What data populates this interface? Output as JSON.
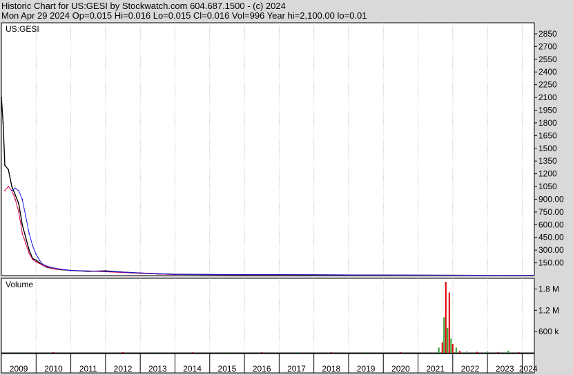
{
  "header": {
    "line1": "Historic Chart for US:GESI by Stockwatch.com 604.687.1500 - (c) 2024",
    "line2": "Mon Apr 29 2024   Op=0.015  Hi=0.016  Lo=0.015  Cl=0.016  Vol=996  Year hi=2,100.00  lo=0.01"
  },
  "chart_data": [
    {
      "type": "line",
      "label": "US:GESI",
      "ylim": [
        0,
        2980
      ],
      "yticks": [
        "2850",
        "2700",
        "2550",
        "2400",
        "2250",
        "2100",
        "1950",
        "1800",
        "1650",
        "1500",
        "1350",
        "1200",
        "1050",
        "900.00",
        "750.00",
        "600.00",
        "450.00",
        "300.00",
        "150.00"
      ],
      "ytick_values": [
        2850,
        2700,
        2550,
        2400,
        2250,
        2100,
        1950,
        1800,
        1650,
        1500,
        1350,
        1200,
        1050,
        900,
        750,
        600,
        450,
        300,
        150
      ],
      "x_years": [
        "2009",
        "2010",
        "2011",
        "2012",
        "2013",
        "2014",
        "2015",
        "2016",
        "2017",
        "2018",
        "2019",
        "2020",
        "2021",
        "2022",
        "2023",
        "2024"
      ],
      "series": [
        {
          "name": "price",
          "x": [
            2009.0,
            2009.05,
            2009.1,
            2009.2,
            2009.3,
            2009.4,
            2009.5,
            2009.6,
            2009.7,
            2009.8,
            2009.9,
            2010.0,
            2010.1,
            2010.2,
            2010.3,
            2010.5,
            2010.7,
            2011.0,
            2011.5,
            2012.0,
            2012.5,
            2013.0,
            2013.5,
            2014.0,
            2016.0,
            2018.0,
            2020.0,
            2022.0,
            2024.3
          ],
          "y": [
            2100,
            1800,
            1300,
            1250,
            1050,
            950,
            850,
            600,
            450,
            300,
            200,
            180,
            150,
            120,
            100,
            80,
            70,
            60,
            50,
            55,
            40,
            30,
            20,
            15,
            10,
            8,
            5,
            3,
            0.016
          ]
        },
        {
          "name": "ma-red",
          "x": [
            2009.1,
            2009.2,
            2009.3,
            2009.4,
            2009.5,
            2009.6,
            2009.7,
            2009.8,
            2009.9,
            2010.0,
            2010.2,
            2010.5,
            2011.0,
            2012.0,
            2013.0,
            2014.0,
            2024.3
          ],
          "y": [
            1000,
            1050,
            1000,
            900,
            750,
            500,
            380,
            260,
            190,
            160,
            120,
            80,
            60,
            45,
            25,
            12,
            2
          ]
        },
        {
          "name": "ma-blue",
          "x": [
            2009.3,
            2009.4,
            2009.5,
            2009.6,
            2009.7,
            2009.8,
            2009.9,
            2010.0,
            2010.1,
            2010.2,
            2010.4,
            2010.7,
            2011.0,
            2012.0,
            2013.0,
            2014.0,
            2024.3
          ],
          "y": [
            1000,
            1030,
            1000,
            900,
            700,
            500,
            350,
            250,
            180,
            130,
            100,
            75,
            60,
            50,
            30,
            15,
            2
          ]
        }
      ]
    },
    {
      "type": "bar",
      "label": "Volume",
      "ylim": [
        0,
        2100000
      ],
      "yticks": [
        "1.8 M",
        "1.2 M",
        "600 k"
      ],
      "ytick_values": [
        1800000,
        1200000,
        600000
      ],
      "series": [
        {
          "name": "volume",
          "x": [
            2009.5,
            2010.5,
            2011.5,
            2012.5,
            2013.5,
            2014.5,
            2015.5,
            2016.5,
            2017.5,
            2018.5,
            2019.5,
            2020.5,
            2021.6,
            2021.7,
            2021.75,
            2021.8,
            2021.85,
            2021.9,
            2021.95,
            2022.0,
            2022.1,
            2022.2,
            2022.4,
            2022.7,
            2023.0,
            2023.3,
            2023.6,
            2023.9
          ],
          "values": [
            20000,
            20000,
            15000,
            15000,
            10000,
            10000,
            8000,
            8000,
            8000,
            8000,
            8000,
            15000,
            150000,
            300000,
            1000000,
            2000000,
            700000,
            1700000,
            400000,
            250000,
            150000,
            60000,
            40000,
            30000,
            35000,
            25000,
            60000,
            20000
          ]
        }
      ]
    }
  ]
}
